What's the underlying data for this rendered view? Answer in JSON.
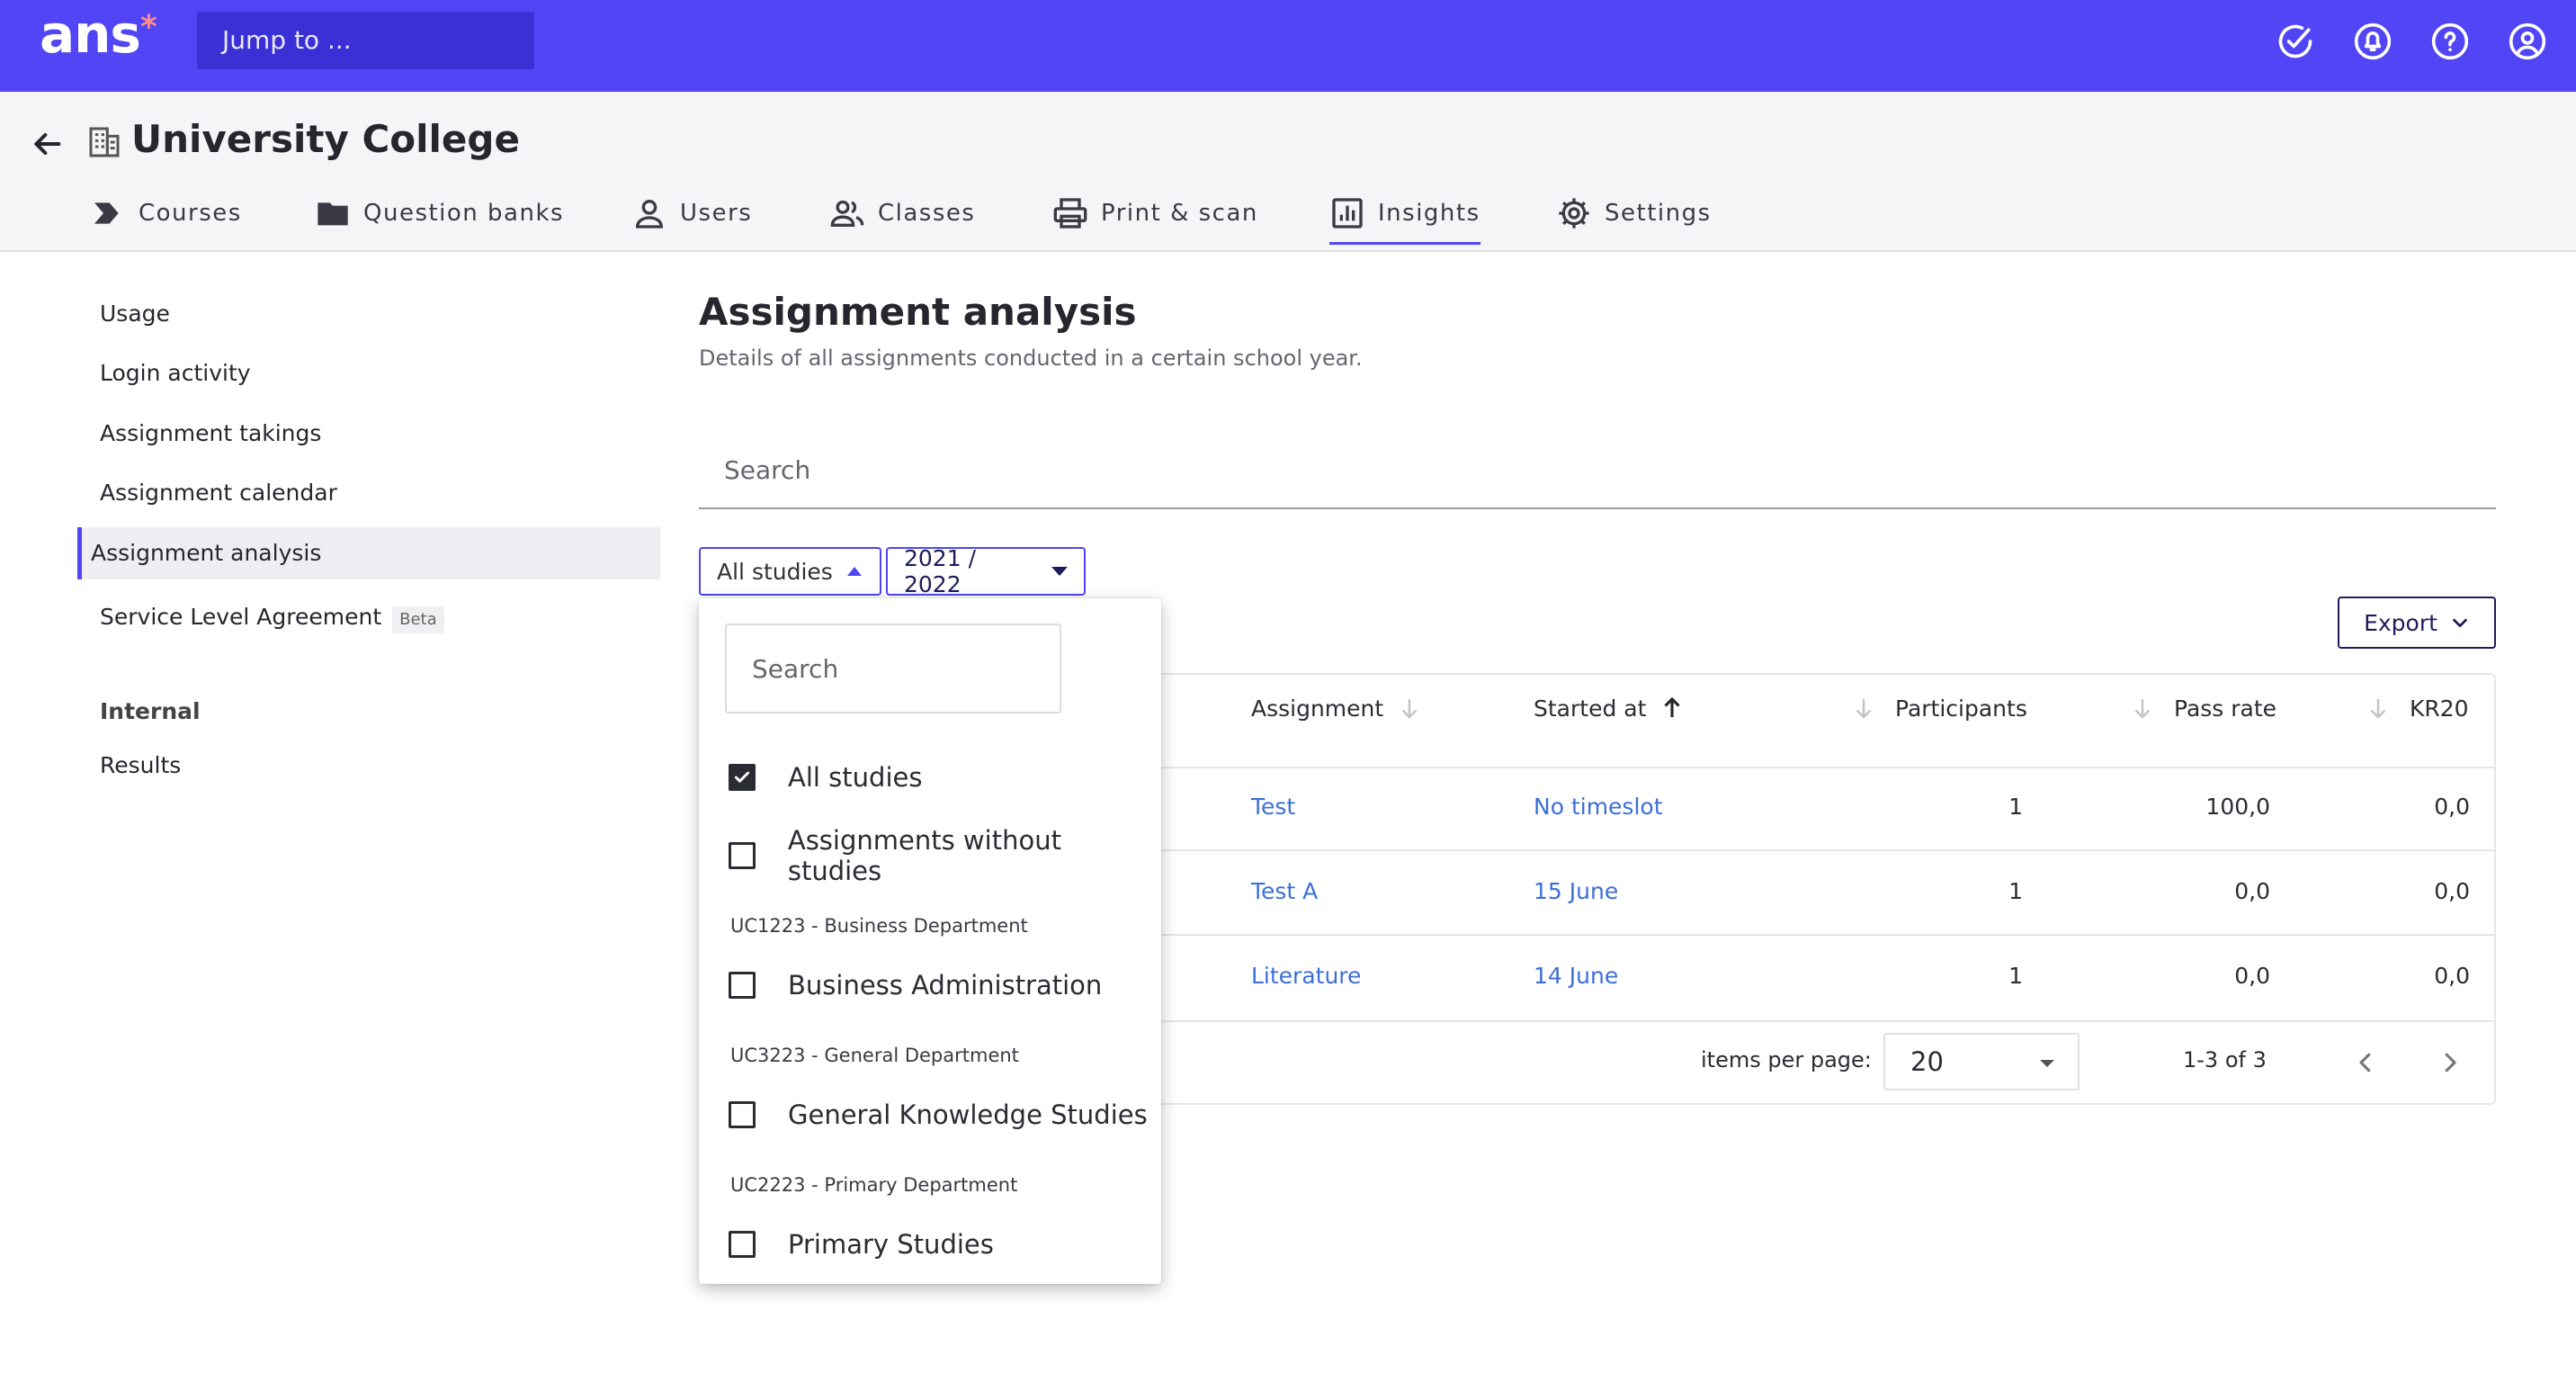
{
  "topbar": {
    "logo": "ans",
    "logo_mark": "*",
    "jump_placeholder": "Jump to ...",
    "icons": [
      "check-circle-icon",
      "bell-icon",
      "help-icon",
      "account-icon"
    ]
  },
  "header": {
    "title": "University College",
    "nav": [
      {
        "label": "Courses",
        "icon": "chevron-tag-icon"
      },
      {
        "label": "Question banks",
        "icon": "folder-icon"
      },
      {
        "label": "Users",
        "icon": "user-icon"
      },
      {
        "label": "Classes",
        "icon": "group-icon"
      },
      {
        "label": "Print & scan",
        "icon": "printer-icon"
      },
      {
        "label": "Insights",
        "icon": "chart-icon",
        "active": true
      },
      {
        "label": "Settings",
        "icon": "gear-icon"
      }
    ]
  },
  "sidebar": {
    "items": [
      {
        "label": "Usage"
      },
      {
        "label": "Login activity"
      },
      {
        "label": "Assignment takings"
      },
      {
        "label": "Assignment calendar"
      },
      {
        "label": "Assignment analysis",
        "active": true
      },
      {
        "label": "Service Level Agreement",
        "badge": "Beta"
      }
    ],
    "section_title": "Internal",
    "section_items": [
      {
        "label": "Results"
      }
    ]
  },
  "main": {
    "title": "Assignment analysis",
    "subtitle": "Details of all assignments conducted in a certain school year.",
    "search_placeholder": "Search",
    "filters": {
      "studies_label": "All studies",
      "year_label": "2021 / 2022"
    },
    "export_label": "Export",
    "table": {
      "columns": [
        "Assignment",
        "Started at",
        "Participants",
        "Pass rate",
        "KR20"
      ],
      "rows": [
        {
          "assignment": "Test",
          "started_at": "No timeslot",
          "participants": "1",
          "pass_rate": "100,0",
          "kr20": "0,0"
        },
        {
          "assignment": "Test A",
          "started_at": "15 June",
          "participants": "1",
          "pass_rate": "0,0",
          "kr20": "0,0"
        },
        {
          "assignment": "Literature",
          "started_at": "14 June",
          "participants": "1",
          "pass_rate": "0,0",
          "kr20": "0,0"
        }
      ]
    },
    "pagination": {
      "items_per_page_label": "items per page:",
      "items_per_page_value": "20",
      "range": "1-3 of 3"
    }
  },
  "dropdown": {
    "search_placeholder": "Search",
    "options": [
      {
        "label": "All studies",
        "checked": true
      },
      {
        "label": "Assignments without studies",
        "checked": false
      }
    ],
    "groups": [
      {
        "title": "UC1223 - Business Department",
        "options": [
          {
            "label": "Business Administration",
            "checked": false
          }
        ]
      },
      {
        "title": "UC3223 - General Department",
        "options": [
          {
            "label": "General Knowledge Studies",
            "checked": false
          }
        ]
      },
      {
        "title": "UC2223 - Primary Department",
        "options": [
          {
            "label": "Primary Studies",
            "checked": false
          }
        ]
      }
    ]
  },
  "colors": {
    "brand": "#5145f5",
    "brand_dark": "#3b2fd6",
    "link": "#3c6fd8",
    "logo_star": "#ff8a8a"
  }
}
